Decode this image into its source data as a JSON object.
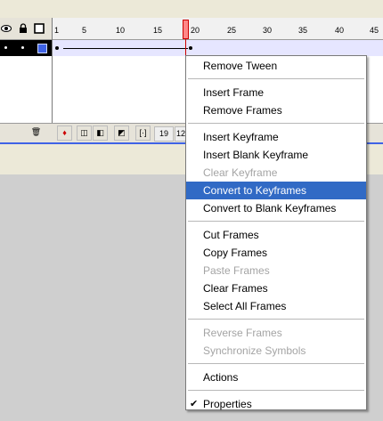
{
  "ruler": {
    "labels": [
      "1",
      "5",
      "10",
      "15",
      "20",
      "25",
      "30",
      "35",
      "40",
      "45"
    ]
  },
  "bottom_bar": {
    "current_frame": "19",
    "frame_rate": "12"
  },
  "colors": {
    "highlight": "#316ac5",
    "layer_color": "#3f63e6",
    "playhead": "#ff8888"
  },
  "menu": {
    "items": [
      {
        "label": "Remove Tween",
        "enabled": true
      },
      {
        "label": "Insert Frame",
        "enabled": true
      },
      {
        "label": "Remove Frames",
        "enabled": true
      },
      {
        "label": "Insert Keyframe",
        "enabled": true
      },
      {
        "label": "Insert Blank Keyframe",
        "enabled": true
      },
      {
        "label": "Clear Keyframe",
        "enabled": false
      },
      {
        "label": "Convert to Keyframes",
        "enabled": true,
        "highlighted": true
      },
      {
        "label": "Convert to Blank Keyframes",
        "enabled": true
      },
      {
        "label": "Cut Frames",
        "enabled": true
      },
      {
        "label": "Copy Frames",
        "enabled": true
      },
      {
        "label": "Paste Frames",
        "enabled": false
      },
      {
        "label": "Clear Frames",
        "enabled": true
      },
      {
        "label": "Select All Frames",
        "enabled": true
      },
      {
        "label": "Reverse Frames",
        "enabled": false
      },
      {
        "label": "Synchronize Symbols",
        "enabled": false
      },
      {
        "label": "Actions",
        "enabled": true
      },
      {
        "label": "Properties",
        "enabled": true,
        "checked": true
      }
    ]
  }
}
